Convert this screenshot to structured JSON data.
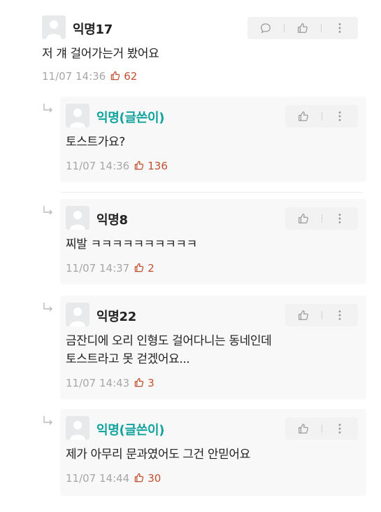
{
  "comments": [
    {
      "nickname": "익명17",
      "text": "저 걔 걸어가는거 봤어요",
      "time": "11/07 14:36",
      "likes": "62",
      "actions": [
        "comment-icon",
        "thumbs-up-icon",
        "more-vertical-icon"
      ]
    }
  ],
  "replies": [
    {
      "nickname": "익명(글쓴이)",
      "is_author": true,
      "text": "토스트가요?",
      "time": "11/07 14:36",
      "likes": "136"
    },
    {
      "nickname": "익명8",
      "is_author": false,
      "text": "찌발 ㅋㅋㅋㅋㅋㅋㅋㅋㅋㅋ",
      "time": "11/07 14:37",
      "likes": "2"
    },
    {
      "nickname": "익명22",
      "is_author": false,
      "text": "금잔디에 오리 인형도 걸어다니는 동네인데\n토스트라고 못 걷겠어요...",
      "time": "11/07 14:43",
      "likes": "3"
    },
    {
      "nickname": "익명(글쓴이)",
      "is_author": true,
      "text": "제가 아무리 문과였어도 그건 안믿어요",
      "time": "11/07 14:44",
      "likes": "30"
    }
  ],
  "colors": {
    "author_nick": "#10a29c",
    "like_count": "#c2502f",
    "meta_gray": "#a7a7a7",
    "reply_bg": "#f8f8f8"
  }
}
